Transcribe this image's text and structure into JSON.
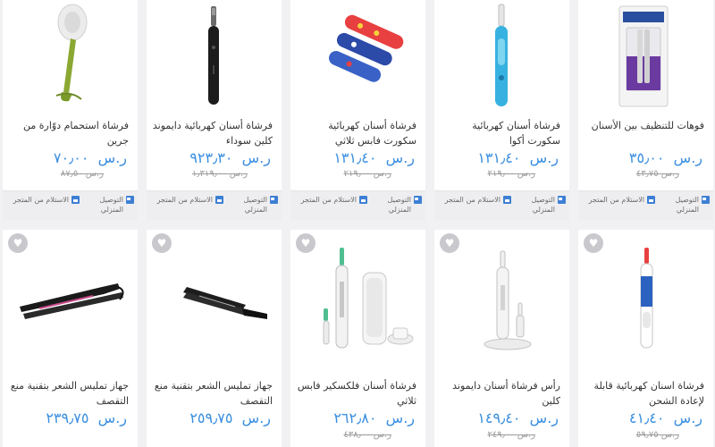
{
  "currency": "ر.س",
  "delivery": {
    "home_label": "التوصيل المنزلي",
    "store_label": "الاستلام من المتجر"
  },
  "row1": [
    {
      "name": "فرشاة استحمام دوّارة من جرين",
      "price": "٧٠٫٠٠",
      "old_price": "٨٧٫٥٠"
    },
    {
      "name": "فرشاة أسنان كهربائية دايموند كلين سوداء",
      "price": "٩٢٣٫٣٠",
      "old_price": "١٫٣١٩٫٠٠"
    },
    {
      "name": "فرشاة أسنان كهربائية سكورت فابس ثلاثي",
      "price": "١٣١٫٤٠",
      "old_price": "٢١٩٫٠٠"
    },
    {
      "name": "فرشاة أسنان كهربائية سكورت أكوا",
      "price": "١٣١٫٤٠",
      "old_price": "٢١٩٫٠٠"
    },
    {
      "name": "فوهات للتنظيف بين الأسنان",
      "price": "٣٥٫٠٠",
      "old_price": "٤٣٫٧٥"
    }
  ],
  "row2": [
    {
      "name": "جهاز تمليس الشعر بتقنية منع التقصف",
      "price": "٢٣٩٫٧٥",
      "old_price": ""
    },
    {
      "name": "جهاز تمليس الشعر بتقنية منع التقصف",
      "price": "٢٥٩٫٧٥",
      "old_price": ""
    },
    {
      "name": "فرشاة أسنان فلكسكير فابس ثلاثي",
      "price": "٢٦٢٫٨٠",
      "old_price": "٤٣٨٫٠٠"
    },
    {
      "name": "رأس فرشاة أسنان دايموند كلين",
      "price": "١٤٩٫٤٠",
      "old_price": "٢٤٩٫٠٠"
    },
    {
      "name": "فرشاة اسنان كهربائية قابلة لإعادة الشحن",
      "price": "٤١٫٤٠",
      "old_price": "٥٩٫٧٥"
    }
  ],
  "fav_icon": "heart-icon"
}
